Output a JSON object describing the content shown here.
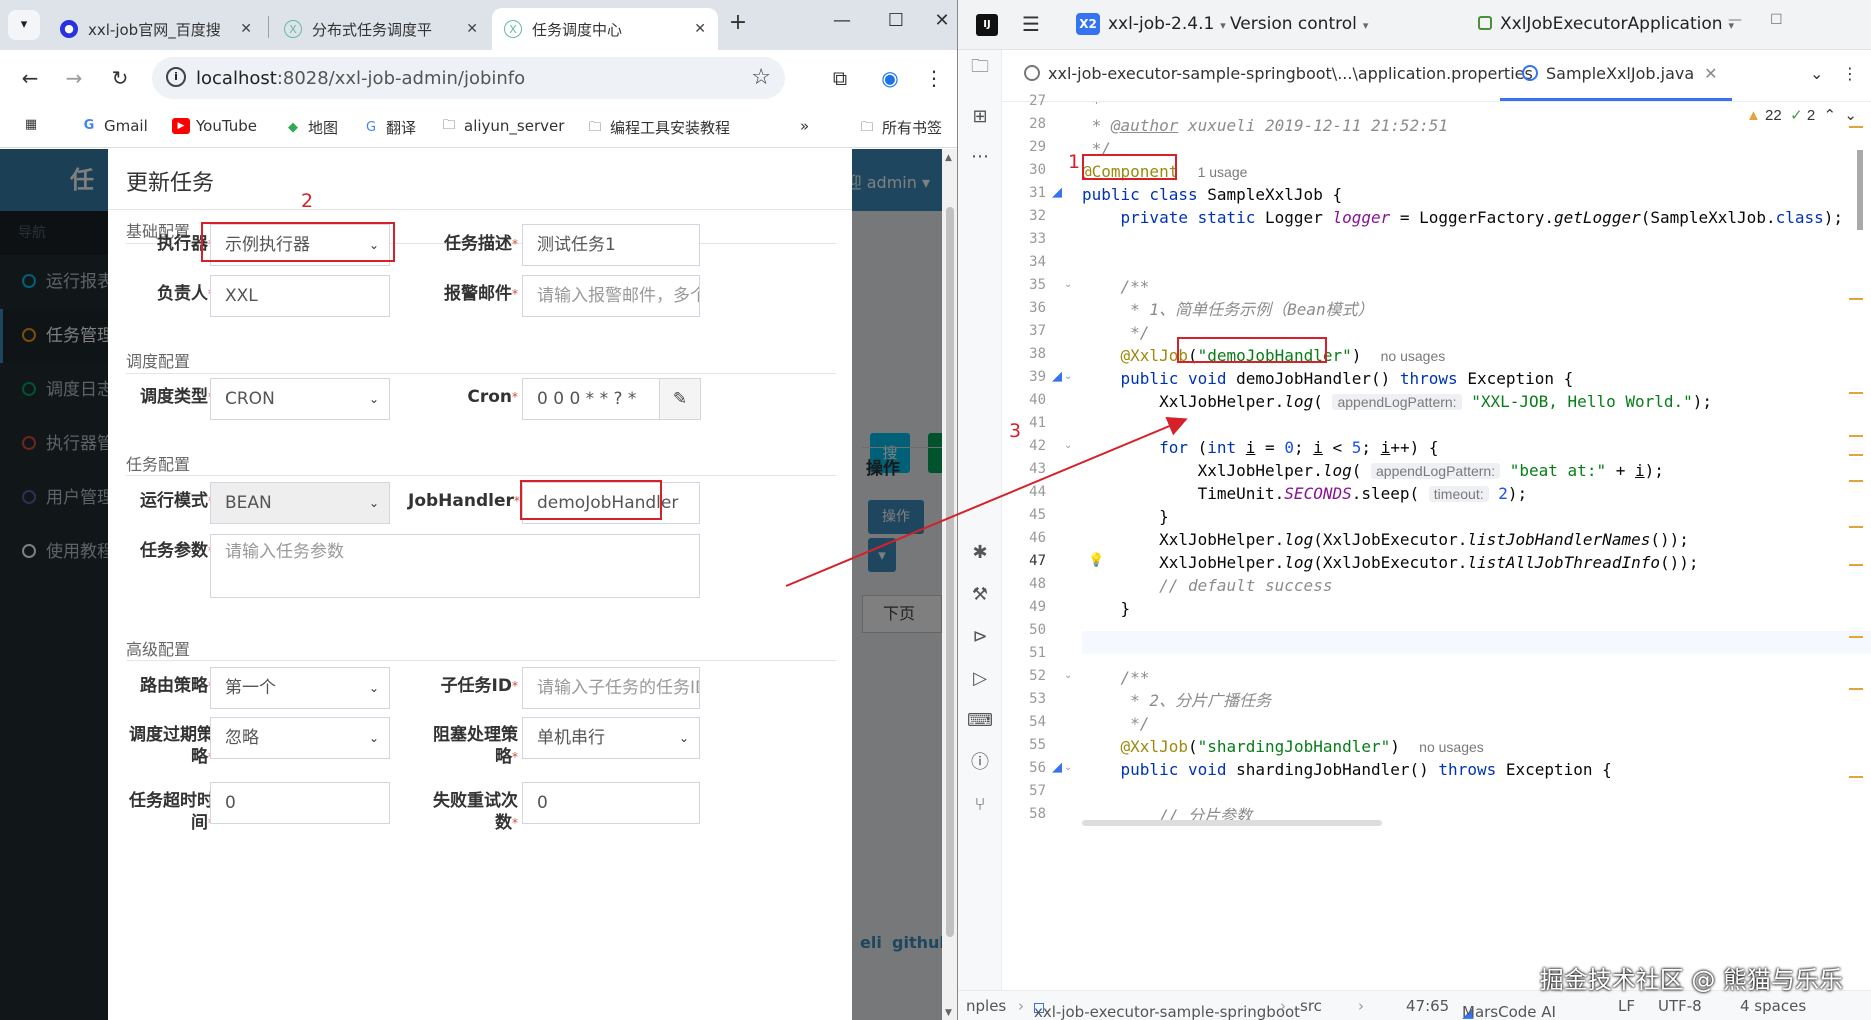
{
  "browser": {
    "tabs": [
      {
        "title": "xxl-job官网_百度搜",
        "icon": "baidu-icon"
      },
      {
        "title": "分布式任务调度平",
        "icon": "xxl-icon"
      },
      {
        "title": "任务调度中心",
        "icon": "xxl-icon"
      }
    ],
    "new_tab": "+",
    "url_host": "localhost",
    "url_rest": ":8028/xxl-job-admin/jobinfo",
    "bookmarks": [
      {
        "label": "Gmail",
        "icon": "google-icon"
      },
      {
        "label": "YouTube",
        "icon": "youtube-icon"
      },
      {
        "label": "地图",
        "icon": "maps-icon"
      },
      {
        "label": "翻译",
        "icon": "translate-icon"
      },
      {
        "label": "aliyun_server",
        "icon": "folder-icon"
      },
      {
        "label": "编程工具安装教程",
        "icon": "folder-icon"
      }
    ],
    "bookmarks_more": "»",
    "all_bookmarks": "所有书签"
  },
  "admin": {
    "logo_text": "任务",
    "nav_header": "导航",
    "sidebar": [
      {
        "label": "运行报表",
        "color": "#00c0ef"
      },
      {
        "label": "任务管理",
        "color": "#f39c12"
      },
      {
        "label": "调度日志",
        "color": "#00a65a"
      },
      {
        "label": "执行器管理",
        "color": "#dd4b39"
      },
      {
        "label": "用户管理",
        "color": "#605ca8"
      },
      {
        "label": "使用教程",
        "color": "#ffffff"
      }
    ],
    "welcome": "迎 admin ▾",
    "search_btn": "搜",
    "ops_header": "操作",
    "ops_btn": "操作",
    "next_page": "下页",
    "footer_left": "eli",
    "footer_right": "github"
  },
  "modal": {
    "title": "更新任务",
    "sections": {
      "basic": "基础配置",
      "schedule": "调度配置",
      "task": "任务配置",
      "advanced": "高级配置"
    },
    "fields": {
      "executor_label": "执行器",
      "executor_value": "示例执行器",
      "desc_label": "任务描述",
      "desc_value": "测试任务1",
      "owner_label": "负责人",
      "owner_value": "XXL",
      "alarm_label": "报警邮件",
      "alarm_placeholder": "请输入报警邮件，多个邮",
      "sched_type_label": "调度类型",
      "sched_type_value": "CRON",
      "cron_label": "Cron",
      "cron_value": "0 0 0 * * ? *",
      "run_mode_label": "运行模式",
      "run_mode_value": "BEAN",
      "handler_label": "JobHandler",
      "handler_value": "demoJobHandler",
      "param_label": "任务参数",
      "param_placeholder": "请输入任务参数",
      "route_label": "路由策略",
      "route_value": "第一个",
      "child_label": "子任务ID",
      "child_placeholder": "请输入子任务的任务ID,",
      "misfire_label_1": "调度过期策",
      "misfire_label_2": "略",
      "misfire_value": "忽略",
      "block_label_1": "阻塞处理策",
      "block_label_2": "略",
      "block_value": "单机串行",
      "timeout_label_1": "任务超时时",
      "timeout_label_2": "间",
      "timeout_value": "0",
      "retry_label_1": "失败重试次",
      "retry_label_2": "数",
      "retry_value": "0"
    },
    "required_mark": "*"
  },
  "annotations": [
    "1",
    "2",
    "3"
  ],
  "ide": {
    "project": "xxl-job-2.4.1",
    "project_badge": "X2",
    "vcs": "Version control",
    "run_config": "XxlJobExecutorApplication",
    "tabs": [
      {
        "label": "xxl-job-executor-sample-springboot\\...\\application.properties",
        "icon": "settings-file-icon"
      },
      {
        "label": "SampleXxlJob.java",
        "icon": "java-class-icon"
      }
    ],
    "inspections": {
      "warnings": "22",
      "checks": "2"
    },
    "line_start": 27,
    "line_end": 58,
    "current_line": 47,
    "hints": {
      "usage_1": "1 usage",
      "no_usages": "no usages",
      "append_param": "appendLogPattern:",
      "timeout_param": "timeout:"
    },
    "status": {
      "breadcrumb_1": "nples",
      "breadcrumb_2": "xxl-job-executor-sample-springboot",
      "breadcrumb_3": "src",
      "position": "47:65",
      "plugin": "MarsCode AI",
      "line_sep": "LF",
      "encoding": "UTF-8",
      "indent": "4 spaces"
    }
  },
  "watermark": "掘金技术社区 @ 熊猫与乐乐"
}
